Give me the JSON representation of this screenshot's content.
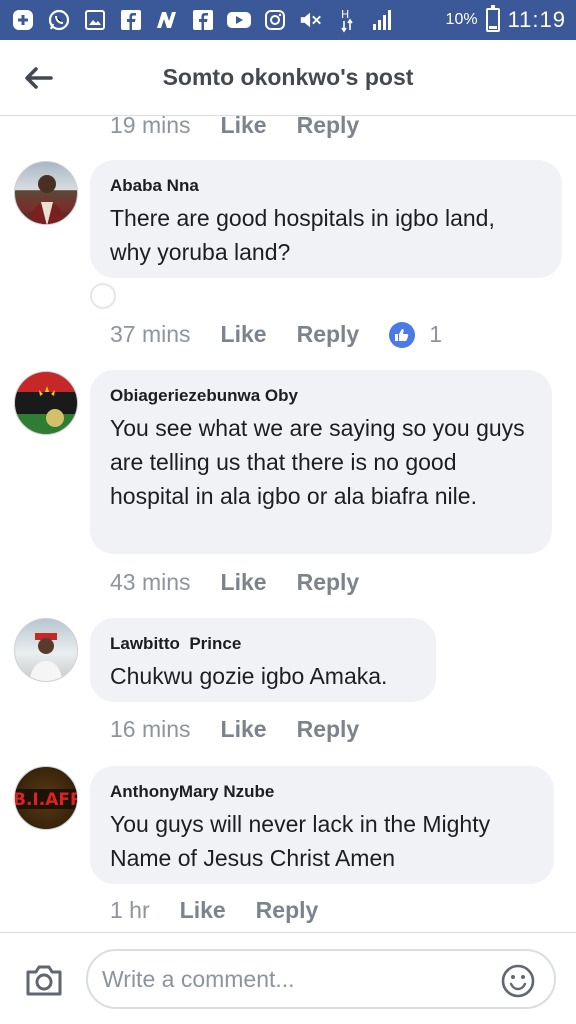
{
  "statusbar": {
    "icons": [
      "plus-icon",
      "whatsapp-icon",
      "gallery-icon",
      "facebook-icon",
      "news-icon",
      "facebook-icon",
      "youtube-icon",
      "instagram-icon",
      "mute-icon",
      "data-icon",
      "signal-icon"
    ],
    "battery_percent": "10%",
    "time": "11:19"
  },
  "header": {
    "title": "Somto okonkwo's post"
  },
  "comments": [
    {
      "time": "19 mins",
      "like": "Like",
      "reply": "Reply"
    },
    {
      "author": "Ababa Nna",
      "text": "There are good hospitals in igbo land, why yoruba land?",
      "time": "37 mins",
      "like": "Like",
      "reply": "Reply",
      "reactions": "1"
    },
    {
      "author": "Obiageriezebunwa Oby",
      "text": "You see what we are saying so you guys are telling us that there is no good hospital in ala igbo or ala biafra nile.",
      "time": "43 mins",
      "like": "Like",
      "reply": "Reply"
    },
    {
      "author": "Lawbitto  Prince",
      "text": "Chukwu gozie igbo Amaka.",
      "time": "16 mins",
      "like": "Like",
      "reply": "Reply"
    },
    {
      "author": "AnthonyMary Nzube",
      "text": "You guys will never lack in the Mighty Name of Jesus Christ Amen",
      "time": "1 hr",
      "like": "Like",
      "reply": "Reply",
      "avatar_text": "B.I.AFR"
    }
  ],
  "composer": {
    "placeholder": "Write a comment..."
  },
  "colors": {
    "statusbar": "#3b5898",
    "bubble": "#f0f2f5",
    "like_badge": "#4a7ae6"
  }
}
